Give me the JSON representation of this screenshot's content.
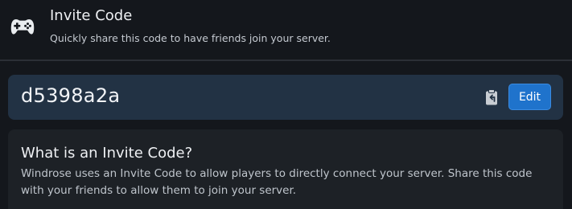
{
  "header": {
    "icon": "gamepad-icon",
    "title": "Invite Code",
    "subtitle": "Quickly share this code to have friends join your server."
  },
  "code_card": {
    "code": "d5398a2a",
    "copy_icon": "clipboard-copy-icon",
    "edit_label": "Edit"
  },
  "info_card": {
    "title": "What is an Invite Code?",
    "body": "Windrose uses an Invite Code to allow players to directly connect your server. Share this code with your friends to allow them to join your server."
  },
  "colors": {
    "background": "#14171c",
    "code_card": "#223244",
    "info_card": "#1d2126",
    "accent": "#1f73cc"
  }
}
